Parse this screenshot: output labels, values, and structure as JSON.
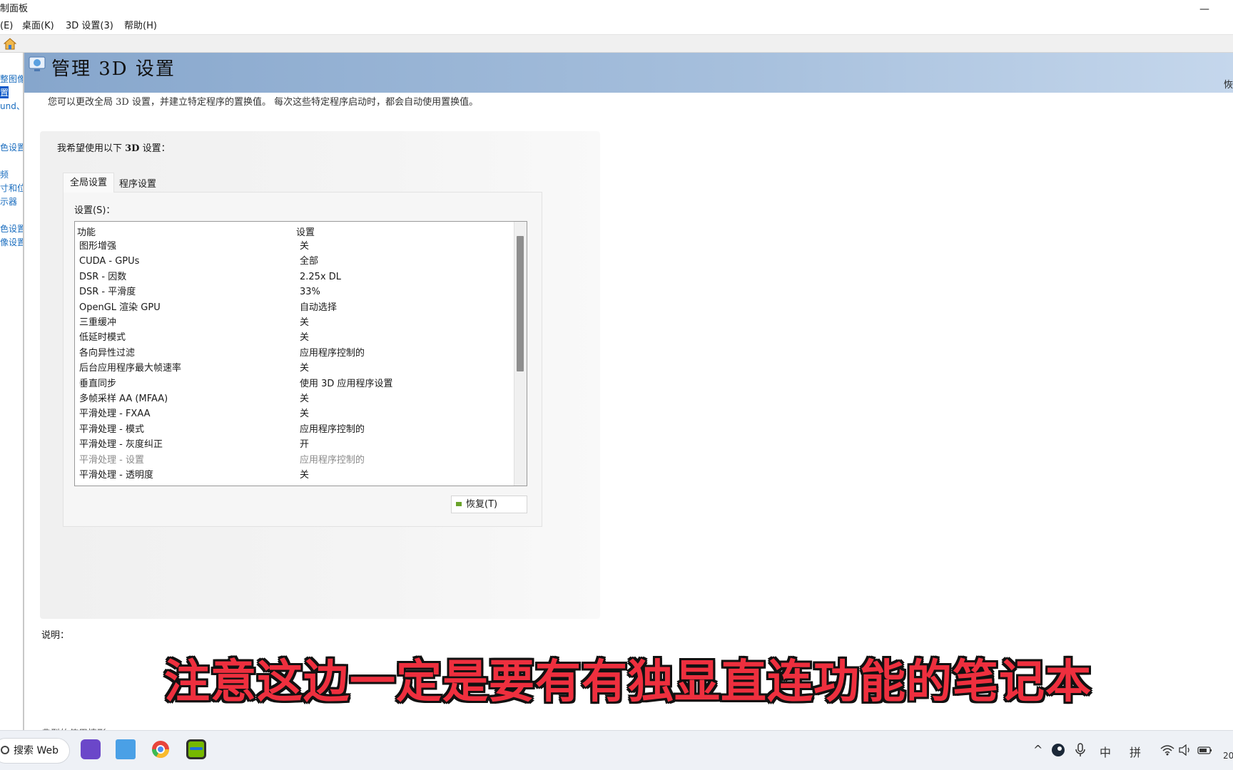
{
  "window": {
    "title": "制面板",
    "minimize_glyph": "—"
  },
  "menu": [
    "(E)",
    "桌面(K)",
    "3D 设置(3)",
    "帮助(H)"
  ],
  "left_nav": [
    "整图像",
    "置",
    "und、",
    "色设置",
    "频",
    "寸和位",
    "示器",
    "色设置",
    "像设置"
  ],
  "header": {
    "title": "管理 3D 设置",
    "restore_link": "恢"
  },
  "intro": "您可以更改全局 3D 设置，并建立特定程序的置换值。 每次这些特定程序启动时，都会自动使用置换值。",
  "panel": {
    "label_prefix": "我希望使用以下 ",
    "label_bold": "3D",
    "label_suffix": " 设置：",
    "tabs": [
      "全局设置",
      "程序设置"
    ],
    "settings_label": "设置(S)：",
    "columns": [
      "功能",
      "设置"
    ],
    "rows": [
      {
        "feature": "图形增强",
        "value": "关",
        "disabled": false
      },
      {
        "feature": "CUDA - GPUs",
        "value": "全部",
        "disabled": false
      },
      {
        "feature": "DSR - 因数",
        "value": "2.25x DL",
        "disabled": false
      },
      {
        "feature": "DSR - 平滑度",
        "value": "33%",
        "disabled": false
      },
      {
        "feature": "OpenGL 渲染 GPU",
        "value": "自动选择",
        "disabled": false
      },
      {
        "feature": "三重缓冲",
        "value": "关",
        "disabled": false
      },
      {
        "feature": "低延时模式",
        "value": "关",
        "disabled": false
      },
      {
        "feature": "各向异性过滤",
        "value": "应用程序控制的",
        "disabled": false
      },
      {
        "feature": "后台应用程序最大帧速率",
        "value": "关",
        "disabled": false
      },
      {
        "feature": "垂直同步",
        "value": "使用 3D 应用程序设置",
        "disabled": false
      },
      {
        "feature": "多帧采样 AA (MFAA)",
        "value": "关",
        "disabled": false
      },
      {
        "feature": "平滑处理 - FXAA",
        "value": "关",
        "disabled": false
      },
      {
        "feature": "平滑处理 - 模式",
        "value": "应用程序控制的",
        "disabled": false
      },
      {
        "feature": "平滑处理 - 灰度纠正",
        "value": "开",
        "disabled": false
      },
      {
        "feature": "平滑处理 - 设置",
        "value": "应用程序控制的",
        "disabled": true
      },
      {
        "feature": "平滑处理 - 透明度",
        "value": "关",
        "disabled": false
      }
    ],
    "restore_button": "恢复(T)"
  },
  "description_label": "说明：",
  "cut_text": "典型的使用情形：",
  "caption": "注意这边一定是要有有独显直连功能的笔记本",
  "taskbar": {
    "search_label": "搜索 Web",
    "tray": {
      "chevron": "^",
      "ime_lang": "中",
      "ime_mode": "拼",
      "clock_fragment": "20"
    }
  },
  "colors": {
    "header_start": "#86a6cc",
    "header_end": "#c5d7ec",
    "caption": "#ee2f3e",
    "nav_link": "#1a6dbf",
    "nvidia_green": "#76b900"
  }
}
